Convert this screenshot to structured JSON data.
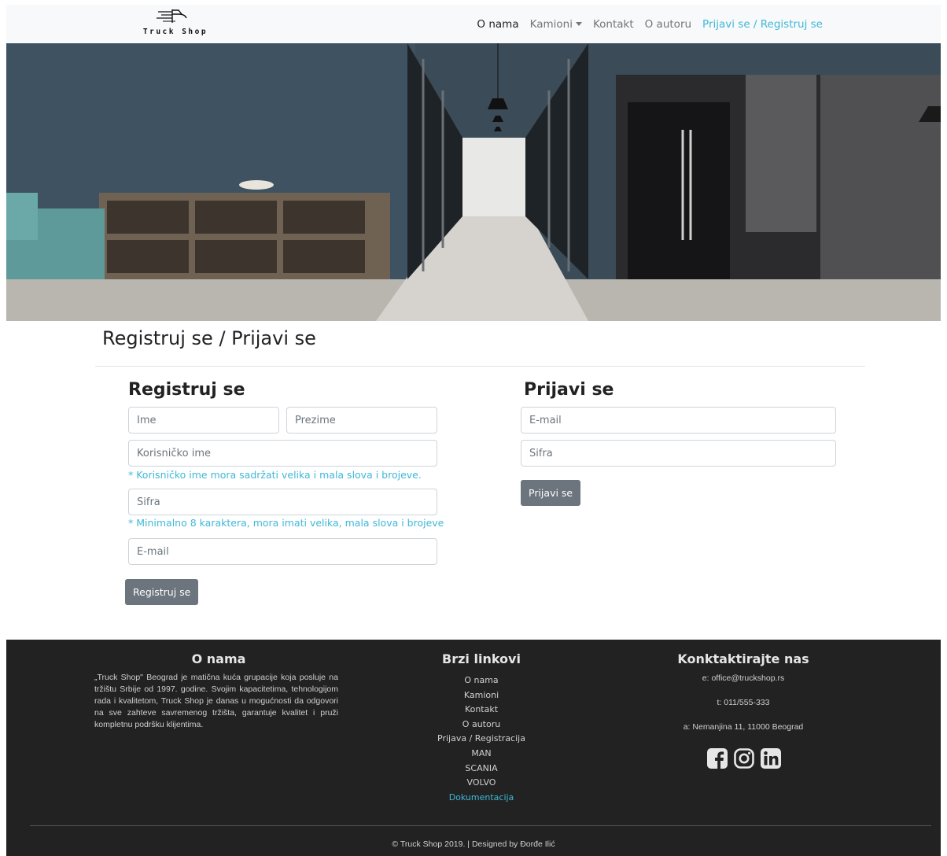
{
  "brand": {
    "name": "Truck Shop"
  },
  "nav": {
    "items": [
      {
        "label": "O nama"
      },
      {
        "label": "Kamioni"
      },
      {
        "label": "Kontakt"
      },
      {
        "label": "O autoru"
      },
      {
        "label": "Prijavi se / Registruj se"
      }
    ]
  },
  "page": {
    "title": "Registruj se / Prijavi se"
  },
  "register": {
    "title": "Registruj se",
    "first_name_placeholder": "Ime",
    "last_name_placeholder": "Prezime",
    "username_placeholder": "Korisničko ime",
    "username_hint": "* Korisničko ime mora sadržati velika i mala slova i brojeve.",
    "password_placeholder": "Šifra",
    "password_hint": "* Minimalno 8 karaktera, mora imati velika, mala slova i brojeve",
    "email_placeholder": "E-mail",
    "button": "Registruj se"
  },
  "login": {
    "title": "Prijavi se",
    "email_placeholder": "E-mail",
    "password_placeholder": "Šifra",
    "button": "Prijavi se"
  },
  "footer": {
    "about_title": "O nama",
    "about_text": "„Truck Shop\" Beograd je matična kuća grupacije koja posluje na tržištu Srbije od 1997. godine. Svojim kapacitetima, tehnologijom rada i kvalitetom, Truck Shop je danas u mogućnosti da odgovori na sve zahteve savremenog tržišta, garantuje kvalitet i pruži kompletnu podršku klijentima.",
    "links_title": "Brzi linkovi",
    "links": [
      "O nama",
      "Kamioni",
      "Kontakt",
      "O autoru",
      "Prijava / Registracija",
      "MAN",
      "SCANIA",
      "VOLVO",
      "Dokumentacija"
    ],
    "contact_title": "Konktaktirajte nas",
    "email": "e: office@truckshop.rs",
    "phone": "t: 011/555-333",
    "address": "a: Nemanjina 11, 11000 Beograd",
    "socials": [
      "facebook-icon",
      "instagram-icon",
      "linkedin-icon"
    ],
    "copyright": "© Truck Shop 2019. | Designed by Đorđe Ilić"
  },
  "colors": {
    "accent": "#3fb8d8",
    "navbar_bg": "#f8f9fa",
    "footer_bg": "#222222",
    "button_bg": "#6c757d"
  }
}
